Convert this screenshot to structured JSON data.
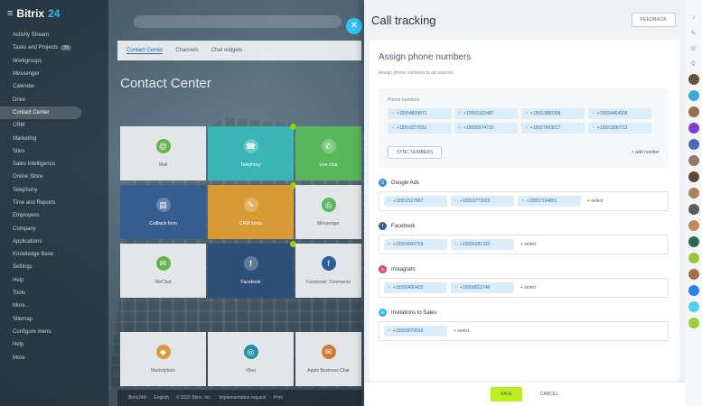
{
  "app": {
    "logo_word": "Bitrix",
    "logo_num": "24",
    "search_placeholder": ""
  },
  "left_menu": {
    "items": [
      {
        "label": "Activity Stream",
        "count": ""
      },
      {
        "label": "Tasks and Projects",
        "count": "99"
      },
      {
        "label": "Workgroups",
        "count": ""
      },
      {
        "label": "Messenger",
        "count": ""
      },
      {
        "label": "Calendar",
        "count": ""
      },
      {
        "label": "Drive",
        "count": ""
      },
      {
        "label": "Contact Center",
        "count": ""
      },
      {
        "label": "CRM",
        "count": ""
      },
      {
        "label": "Marketing",
        "count": ""
      },
      {
        "label": "Sites",
        "count": ""
      },
      {
        "label": "Sales Intelligence",
        "count": ""
      },
      {
        "label": "Online Store",
        "count": ""
      },
      {
        "label": "Telephony",
        "count": ""
      },
      {
        "label": "Time and Reports",
        "count": ""
      },
      {
        "label": "Employees",
        "count": ""
      },
      {
        "label": "Company",
        "count": ""
      },
      {
        "label": "Applications",
        "count": ""
      },
      {
        "label": "Knowledge Base",
        "count": ""
      },
      {
        "label": "Settings",
        "count": ""
      },
      {
        "label": "Help",
        "count": ""
      },
      {
        "label": "Tools",
        "count": ""
      },
      {
        "label": "More...",
        "count": ""
      },
      {
        "label": "Sitemap",
        "count": ""
      },
      {
        "label": "Configure menu",
        "count": ""
      },
      {
        "label": "Help",
        "count": ""
      },
      {
        "label": "More",
        "count": ""
      }
    ],
    "active_index": 6
  },
  "contact_center": {
    "tabs": [
      "Contact Center",
      "Channels",
      "Chat widgets"
    ],
    "heading": "Contact Center",
    "tiles": [
      {
        "label": "Mail",
        "icon": "@"
      },
      {
        "label": "Telephony",
        "icon": "☎"
      },
      {
        "label": "Live chat",
        "icon": "✆"
      },
      {
        "label": "Callback form",
        "icon": "▤"
      },
      {
        "label": "CRM forms",
        "icon": "✎"
      },
      {
        "label": "Messenger",
        "icon": "◎"
      },
      {
        "label": "WeChat",
        "icon": "✉"
      },
      {
        "label": "Facebook",
        "icon": "f"
      },
      {
        "label": "Facebook: Comments",
        "icon": "f"
      },
      {
        "label": "Marketplace",
        "icon": "◆"
      },
      {
        "label": "Viber",
        "icon": "◎"
      },
      {
        "label": "Apple Business Chat",
        "icon": "✉"
      }
    ],
    "footer": [
      "Bitrix24®",
      "English",
      "© 2020 Bitrix, Inc.",
      "Implementation request",
      "Print"
    ]
  },
  "panel": {
    "title": "Call tracking",
    "feedback_label": "Feedback",
    "section_title": "Assign phone numbers",
    "section_subtitle": "Assign phone numbers to ad sources",
    "numbers_label": "Phone numbers",
    "numbers": [
      "+15554839871",
      "+15555102487",
      "+15552880306",
      "+15554464508",
      "+15559273551",
      "+15556074716",
      "+15557593017",
      "+15553399713"
    ],
    "sync_label": "Sync numbers",
    "add_number_label": "+ add number",
    "sources": [
      {
        "name": "Google Ads",
        "color": "#3b87d8",
        "icon": "G",
        "numbers": [
          "+15551527867",
          "+15553773923",
          "+15557194851"
        ],
        "select_label": "+ select"
      },
      {
        "name": "Facebook",
        "color": "#3b5998",
        "icon": "f",
        "numbers": [
          "+15554009759",
          "+15556281332"
        ],
        "select_label": "+ select"
      },
      {
        "name": "Instagram",
        "color": "#d6417a",
        "icon": "◎",
        "numbers": [
          "+15550490433",
          "+15558011748"
        ],
        "select_label": "+ select"
      },
      {
        "name": "Invitations to Sales",
        "color": "#2fb5e6",
        "icon": "✉",
        "numbers": [
          "+15559079010"
        ],
        "select_label": "+ select"
      }
    ],
    "save_label": "Save",
    "cancel_label": "Cancel"
  },
  "right_rail": {
    "icons": [
      "bell-icon",
      "pin-icon",
      "phone-icon",
      "search-icon"
    ],
    "avatar_colors": [
      "#6a4e3e",
      "#3fa7d6",
      "#9b6b4b",
      "#7a3fd0",
      "#4a69bd",
      "#8e7b6c",
      "#5c4a3f",
      "#a58262",
      "#5b5b5b",
      "#c08a60",
      "#2d6b4f",
      "#9bc53d",
      "#a07050",
      "#2f80ed",
      "#56ccf2",
      "#9bcd3a"
    ]
  },
  "colors": {
    "accent": "#2fc6f6",
    "save": "#bbed21",
    "chip_bg": "#dcedf7",
    "chip_text": "#2a72a8"
  }
}
